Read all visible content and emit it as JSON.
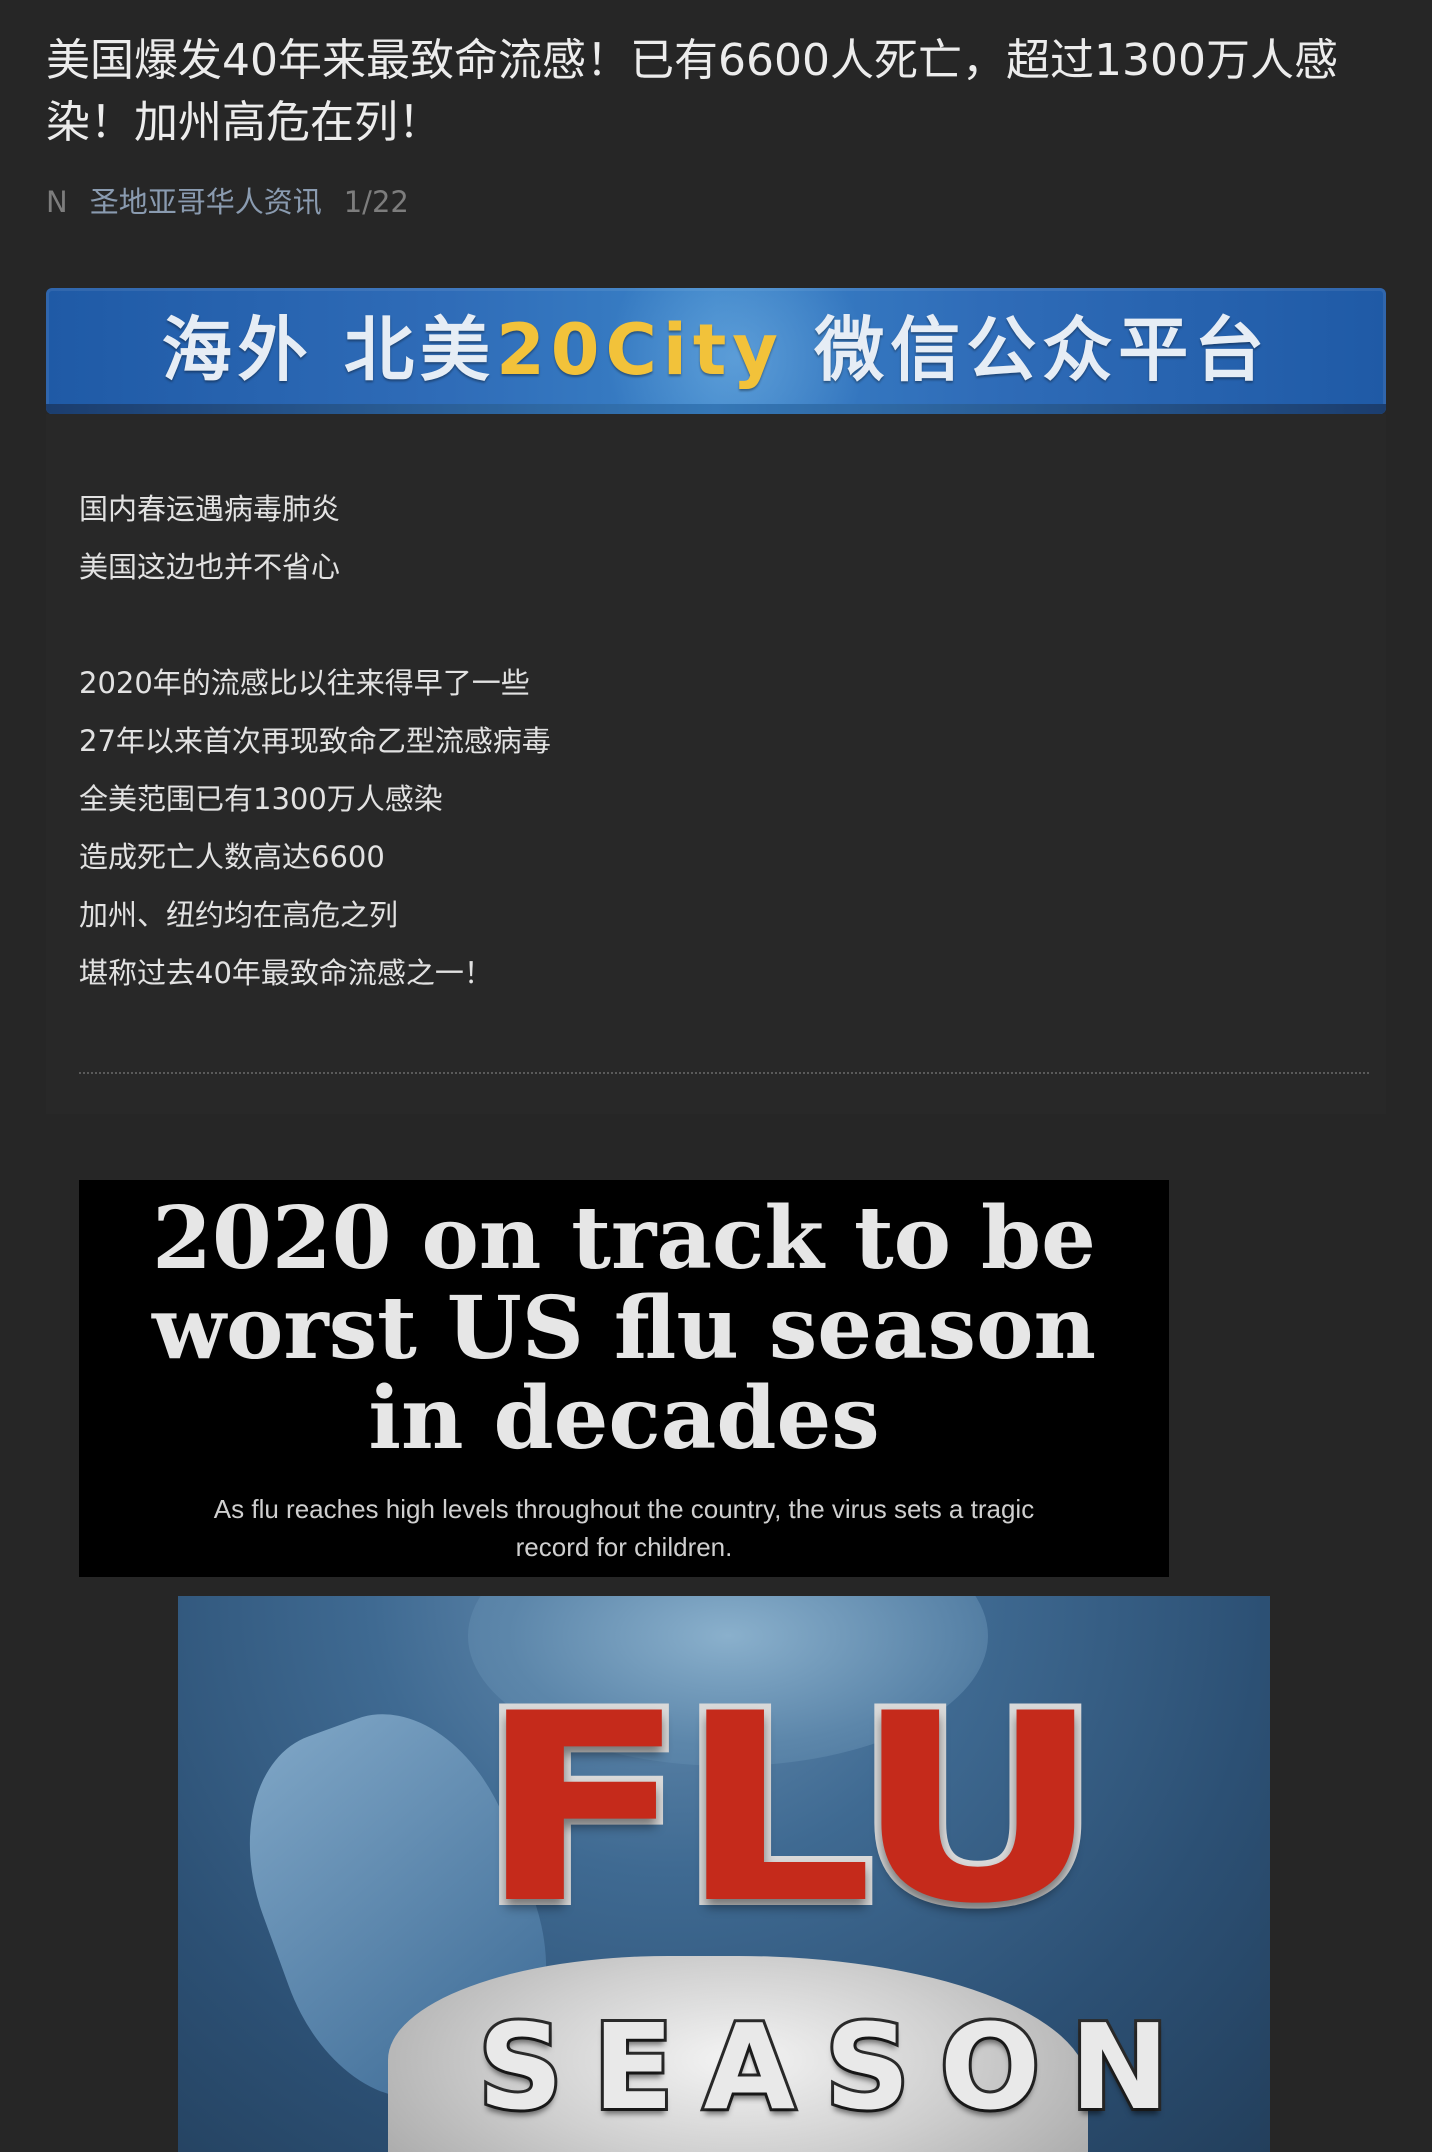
{
  "article": {
    "title": "美国爆发40年来最致命流感！已有6600人死亡，超过1300万人感染！加州高危在列！",
    "meta": {
      "badge": "N",
      "author": "圣地亚哥华人资讯",
      "date": "1/22"
    }
  },
  "banner": {
    "text_prefix": "海外 北美",
    "text_highlight": "20City",
    "text_suffix": "微信公众平台"
  },
  "body": {
    "lines_group1": [
      "国内春运遇病毒肺炎",
      "美国这边也并不省心"
    ],
    "lines_group2": [
      "2020年的流感比以往来得早了一些",
      "27年以来首次再现致命乙型流感病毒",
      "全美范围已有1300万人感染",
      "造成死亡人数高达6600",
      "加州、纽约均在高危之列",
      "堪称过去40年最致命流感之一！"
    ]
  },
  "headline_card": {
    "title": "2020 on track to be worst US flu season in decades",
    "subtitle": "As flu reaches high levels throughout the country, the virus sets a tragic record for children."
  },
  "flu_image": {
    "word_main": "FLU",
    "word_sub": "SEASON"
  },
  "colors": {
    "background": "#262626",
    "banner_blue": "#2f6cb8",
    "banner_gold": "#f2c23a",
    "flu_red": "#c52a1b"
  }
}
